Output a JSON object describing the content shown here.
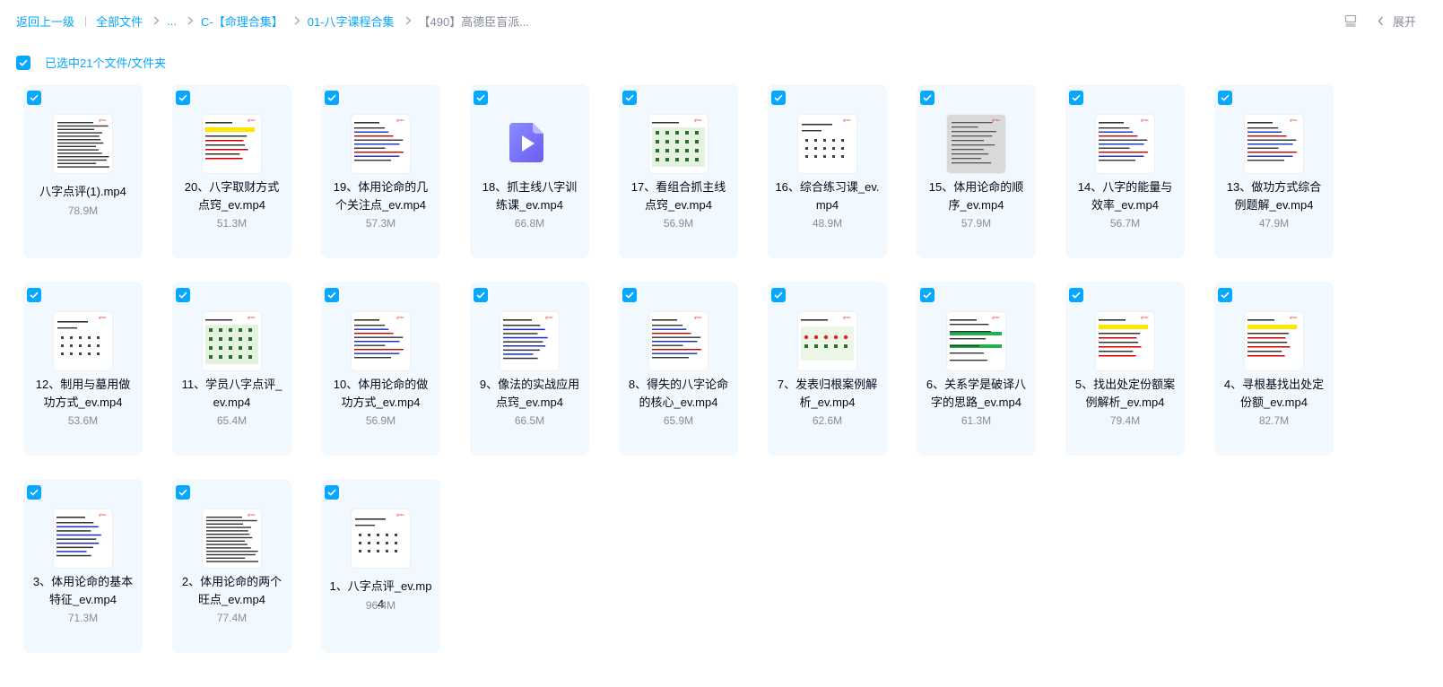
{
  "breadcrumb": {
    "back": "返回上一级",
    "all_files": "全部文件",
    "ellipsis": "...",
    "level1": "C-【命理合集】",
    "level2": "01-八字课程合集",
    "current": "【490】高德臣盲派..."
  },
  "top_right": {
    "expand_label": "展开"
  },
  "selection": {
    "label": "已选中21个文件/文件夹"
  },
  "colors": {
    "accent": "#06a7ff",
    "card_bg": "#f1f9ff",
    "muted": "#878c9c"
  },
  "files": [
    {
      "name": "八字点评(1).mp4",
      "size": "78.9M",
      "thumb": "dense"
    },
    {
      "name": "20、八字取财方式点窍_ev.mp4",
      "size": "51.3M",
      "thumb": "yellow"
    },
    {
      "name": "19、体用论命的几个关注点_ev.mp4",
      "size": "57.3M",
      "thumb": "text"
    },
    {
      "name": "18、抓主线八字训练课_ev.mp4",
      "size": "66.8M",
      "thumb": "video-icon"
    },
    {
      "name": "17、看组合抓主线点窍_ev.mp4",
      "size": "56.9M",
      "thumb": "green"
    },
    {
      "name": "16、综合练习课_ev.mp4",
      "size": "48.9M",
      "thumb": "sparse"
    },
    {
      "name": "15、体用论命的顺序_ev.mp4",
      "size": "57.9M",
      "thumb": "gray"
    },
    {
      "name": "14、八字的能量与效率_ev.mp4",
      "size": "56.7M",
      "thumb": "text"
    },
    {
      "name": "13、做功方式综合例题解_ev.mp4",
      "size": "47.9M",
      "thumb": "text"
    },
    {
      "name": "12、制用与墓用做功方式_ev.mp4",
      "size": "53.6M",
      "thumb": "sparse"
    },
    {
      "name": "11、学员八字点评_ev.mp4",
      "size": "65.4M",
      "thumb": "green"
    },
    {
      "name": "10、体用论命的做功方式_ev.mp4",
      "size": "56.9M",
      "thumb": "text"
    },
    {
      "name": "9、像法的实战应用点窍_ev.mp4",
      "size": "66.5M",
      "thumb": "blue"
    },
    {
      "name": "8、得失的八字论命的核心_ev.mp4",
      "size": "65.9M",
      "thumb": "text"
    },
    {
      "name": "7、发表归根案例解析_ev.mp4",
      "size": "62.6M",
      "thumb": "red"
    },
    {
      "name": "6、关系学是破译八字的思路_ev.mp4",
      "size": "61.3M",
      "thumb": "greenbar"
    },
    {
      "name": "5、找出处定份额案例解析_ev.mp4",
      "size": "79.4M",
      "thumb": "yellow"
    },
    {
      "name": "4、寻根基找出处定份额_ev.mp4",
      "size": "82.7M",
      "thumb": "yellow"
    },
    {
      "name": "3、体用论命的基本特征_ev.mp4",
      "size": "71.3M",
      "thumb": "blue"
    },
    {
      "name": "2、体用论命的两个旺点_ev.mp4",
      "size": "77.4M",
      "thumb": "dense"
    },
    {
      "name": "1、八字点评_ev.mp4",
      "size": "96.4M",
      "thumb": "sparse"
    }
  ]
}
